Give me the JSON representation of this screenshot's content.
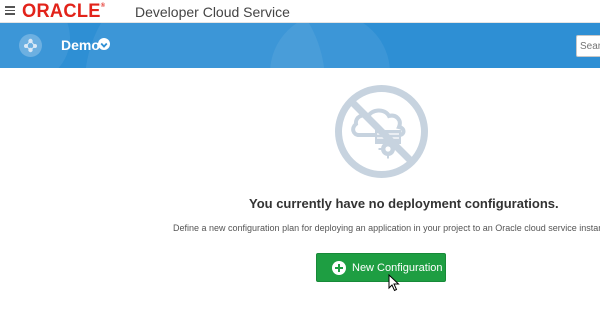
{
  "header": {
    "brand": "ORACLE",
    "registered_mark": "®",
    "product": "Developer Cloud Service"
  },
  "project": {
    "name": "Demo"
  },
  "search": {
    "placeholder": "Sear"
  },
  "empty_state": {
    "title": "You currently have no deployment configurations.",
    "description": "Define a new configuration plan for deploying an application in your project to an Oracle cloud service instance.",
    "button_label": "New Configuration"
  },
  "colors": {
    "brand_red": "#e2231a",
    "project_bar": "#2e8fd4",
    "button_green": "#1e9e42",
    "illustration_gray": "#c7d3df"
  },
  "icons": {
    "menu": "hamburger-menu-icon",
    "project": "project-icon",
    "chevron": "chevron-down-icon",
    "illustration": "no-deployment-icon",
    "plus": "plus-circle-icon"
  }
}
